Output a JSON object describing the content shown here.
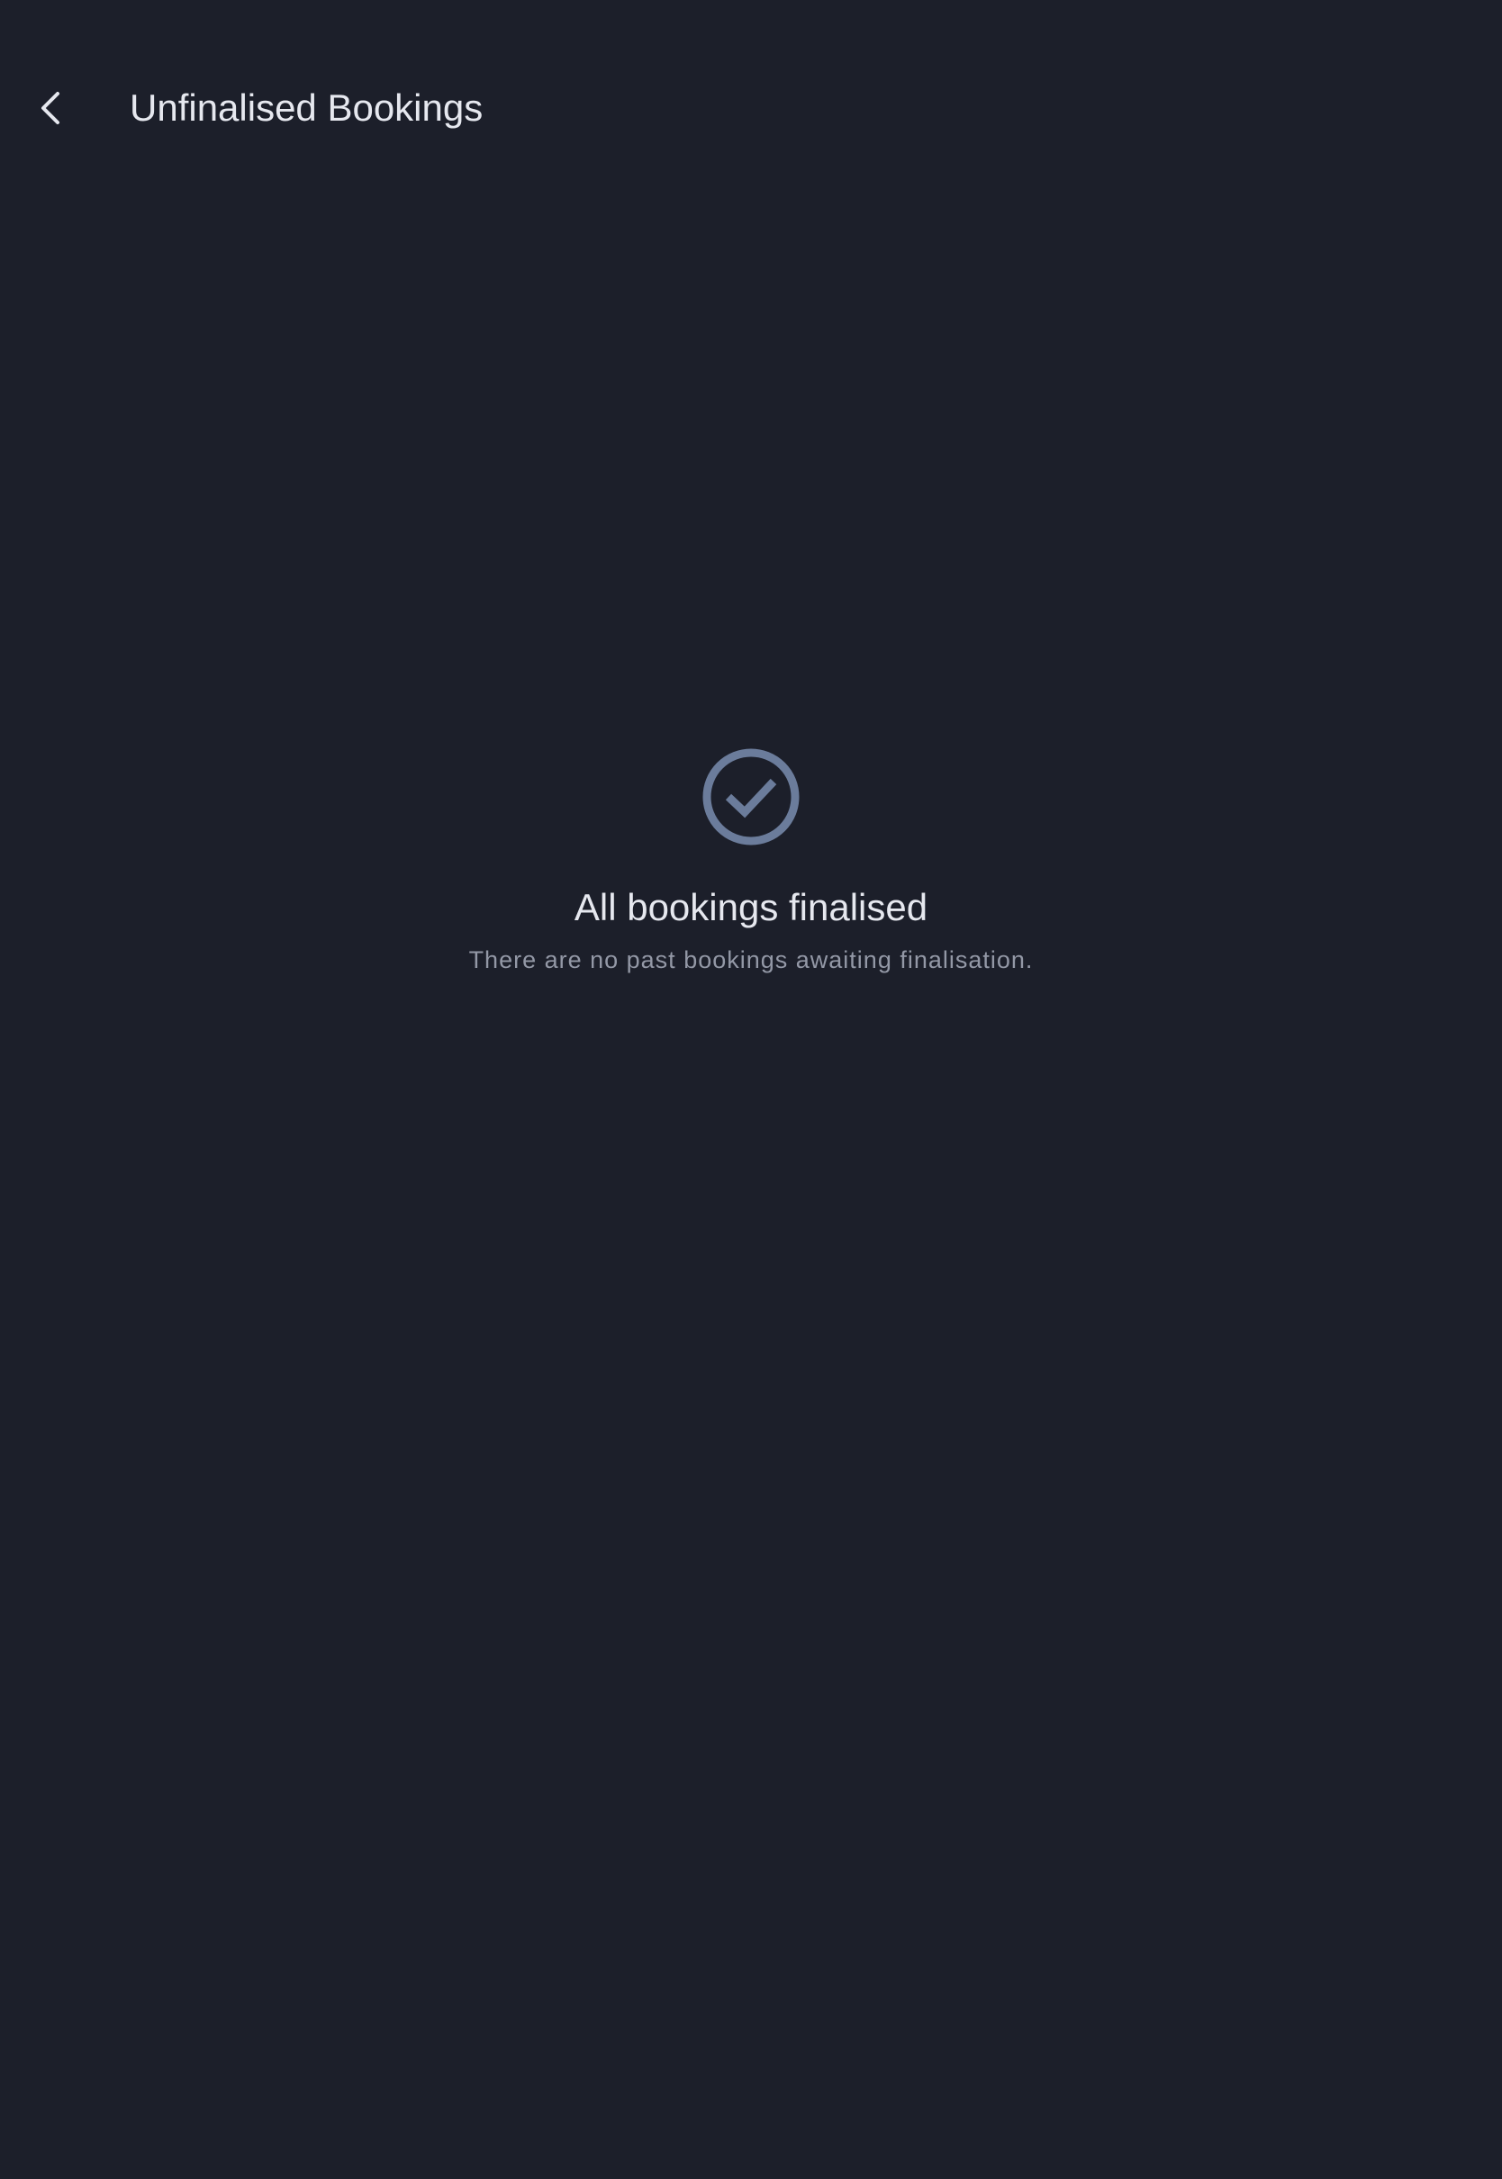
{
  "header": {
    "back_icon": "chevron-left-icon",
    "title": "Unfinalised Bookings"
  },
  "empty_state": {
    "icon": "check-circle-icon",
    "title": "All bookings finalised",
    "subtitle": "There are no past bookings awaiting finalisation."
  },
  "colors": {
    "background": "#1c1f2a",
    "text_primary": "#e6e8ef",
    "text_secondary": "#9398a6",
    "icon_accent": "#6b7c9b"
  }
}
